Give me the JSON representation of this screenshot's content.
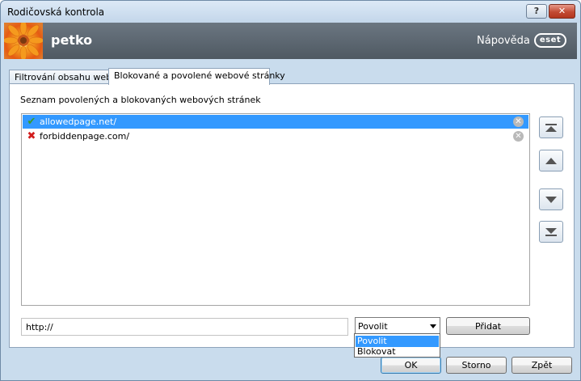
{
  "window": {
    "title": "Rodičovská kontrola",
    "help_button": "?",
    "close_button": "✕"
  },
  "header": {
    "profile_name": "petko",
    "help_link": "Nápověda",
    "brand": "eset"
  },
  "tabs": [
    {
      "label": "Filtrování obsahu webu",
      "active": false
    },
    {
      "label": "Blokované a povolené webové stránky",
      "active": true
    }
  ],
  "panel": {
    "section_label": "Seznam povolených a blokovaných webových stránek",
    "list": [
      {
        "url": "allowedpage.net/",
        "status": "allowed",
        "icon": "check-icon",
        "selected": true
      },
      {
        "url": "forbiddenpage.com/",
        "status": "blocked",
        "icon": "cross-icon",
        "selected": false
      }
    ],
    "order_buttons": [
      "move-top",
      "move-up",
      "move-down",
      "move-bottom"
    ],
    "url_input_value": "http://",
    "action_select": {
      "value": "Povolit",
      "options": [
        "Povolit",
        "Blokovat"
      ],
      "highlighted": "Povolit"
    },
    "add_button": "Přidat"
  },
  "footer": {
    "ok": "OK",
    "cancel": "Storno",
    "back": "Zpět"
  },
  "colors": {
    "selection": "#3399ff",
    "header_bg": "#5c6670",
    "allow": "#3c9b2a",
    "block": "#d21d1d"
  }
}
